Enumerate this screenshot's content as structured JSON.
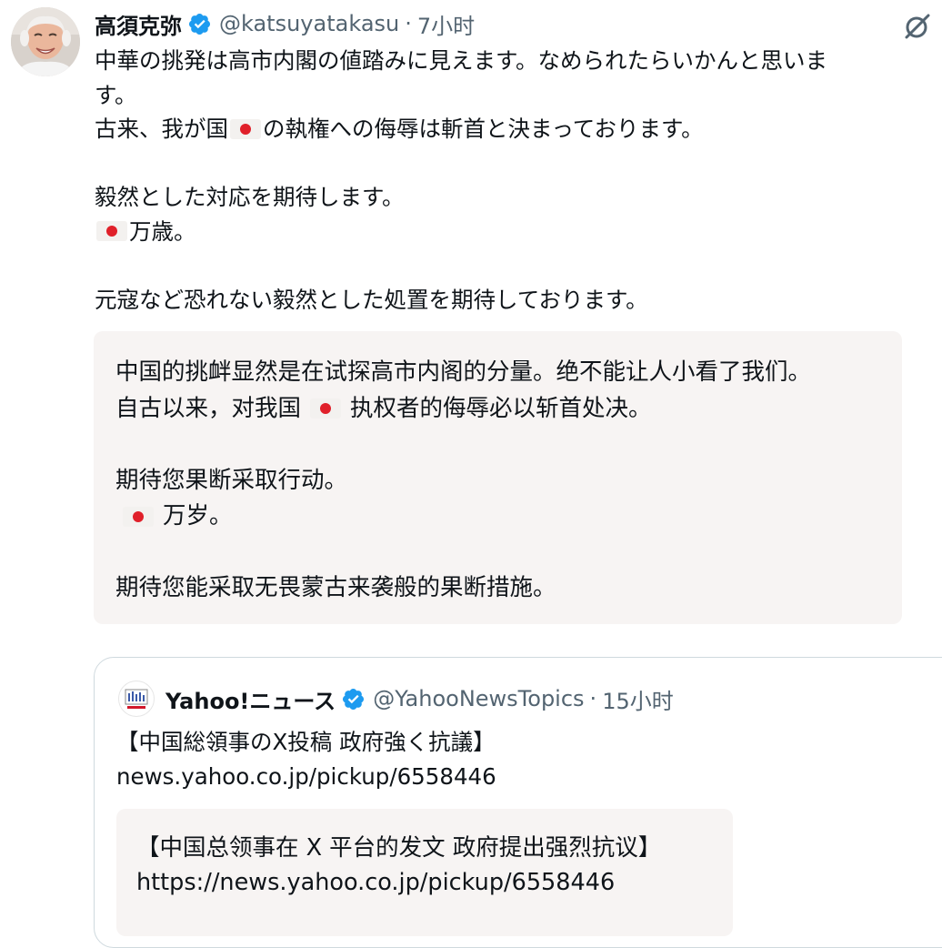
{
  "author": {
    "display_name": "高須克弥",
    "handle": "@katsuyatakasu",
    "separator": "·",
    "time": "7小时",
    "avatar_icon": "profile-photo",
    "verified_icon": "verified-badge-icon",
    "verified_color": "#1d9bf0"
  },
  "translate_icon": "translate-icon",
  "tweet": {
    "line1": "中華の挑発は高市内閣の値踏みに見えます。なめられたらいかんと思いま",
    "line2": "す。",
    "line3_before_flag": "古来、我が国",
    "line3_after_flag": "の執権への侮辱は斬首と決まっております。",
    "line4": "毅然とした対応を期待します。",
    "line5_after_flag": "万歳。",
    "line6": "元寇など恐れない毅然とした処置を期待しております。",
    "flag_icon": "japan-flag-icon"
  },
  "translation": {
    "line1": "中国的挑衅显然是在试探高市内阁的分量。绝不能让人小看了我们。",
    "line2_before_flag": "自古以来，对我国",
    "line2_after_flag": "执权者的侮辱必以斩首处决。",
    "line3": "期待您果断采取行动。",
    "line4_after_flag": "万岁。",
    "line5": "期待您能采取无畏蒙古来袭般的果断措施。"
  },
  "quoted_post": {
    "display_name": "Yahoo!ニュース",
    "handle": "@YahooNewsTopics",
    "separator": "·",
    "time": "15小时",
    "avatar_icon": "yahoo-news-logo",
    "verified_icon": "verified-badge-icon",
    "text_line1": "【中国総領事のX投稿 政府強く抗議】",
    "text_line2": "news.yahoo.co.jp/pickup/6558446",
    "translation_line1": "【中国总领事在 X 平台的发文 政府提出强烈抗议】",
    "translation_line2": "https://news.yahoo.co.jp/pickup/6558446"
  },
  "colors": {
    "text": "#0f1419",
    "secondary": "#536471",
    "translation_bg": "#f7f4f3",
    "card_border": "#cfd9de",
    "flag_red": "#e0202a"
  }
}
